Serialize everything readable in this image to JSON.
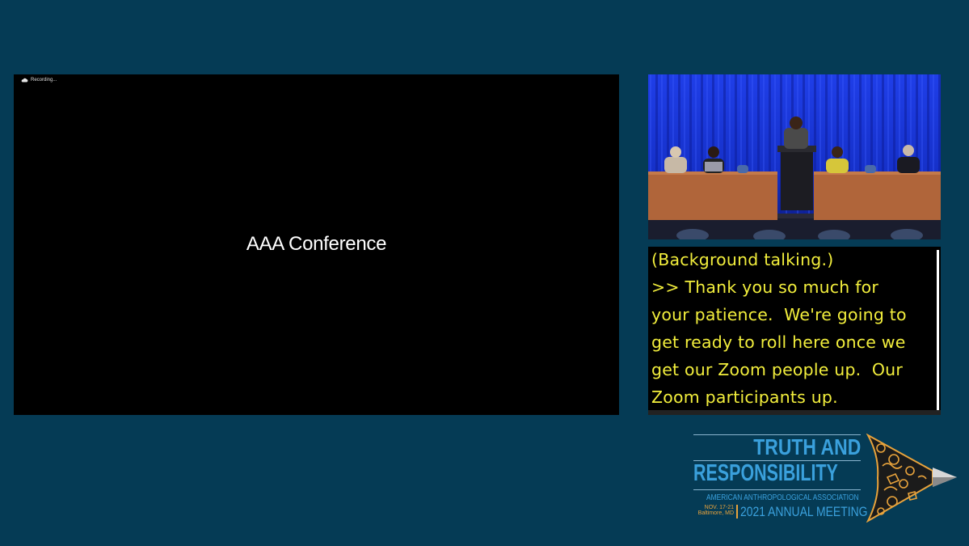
{
  "main_panel": {
    "recording_label": "Recording...",
    "title": "AAA Conference"
  },
  "captions": {
    "text": "(Background talking.)\n>> Thank you so much for\nyour patience.  We're going to\nget ready to roll here once we\nget our Zoom people up.  Our\nZoom participants up."
  },
  "logo": {
    "line1": "TRUTH AND",
    "line2": "RESPONSIBILITY",
    "association": "AMERICAN ANTHROPOLOGICAL ASSOCIATION",
    "date": "NOV. 17-21",
    "location": "Baltimore, MD",
    "meeting": "2021 ANNUAL MEETING"
  },
  "colors": {
    "background": "#053b55",
    "caption_text": "#f2ee3c",
    "logo_blue": "#3aa0dc",
    "logo_orange": "#e8a33c"
  }
}
